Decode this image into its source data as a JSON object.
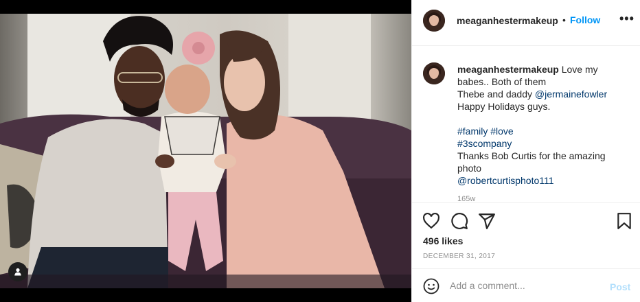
{
  "header": {
    "username": "meaganhestermakeup",
    "separator": "•",
    "follow_label": "Follow",
    "more_label": "•••"
  },
  "caption": {
    "username": "meaganhestermakeup",
    "line1": "Love my babes.. Both of them",
    "line2_prefix": "Thebe and daddy ",
    "mention1": "@jermainefowler",
    "line3": "Happy Holidays guys.",
    "hashtags_line1": "#family #love",
    "hashtag2": "#3scompany",
    "line4": "Thanks Bob Curtis for the amazing photo",
    "mention2": "@robertcurtisphoto111",
    "time": "165w"
  },
  "actions": {
    "likes": "496 likes",
    "date": "DECEMBER 31, 2017"
  },
  "comment": {
    "placeholder": "Add a comment...",
    "post_label": "Post"
  },
  "colors": {
    "accent": "#0095f6",
    "post_disabled": "#b2dffc",
    "link": "#00376b"
  },
  "icons": [
    "heart-icon",
    "comment-icon",
    "share-icon",
    "bookmark-icon",
    "emoji-icon",
    "user-tag-icon",
    "more-options-icon"
  ]
}
